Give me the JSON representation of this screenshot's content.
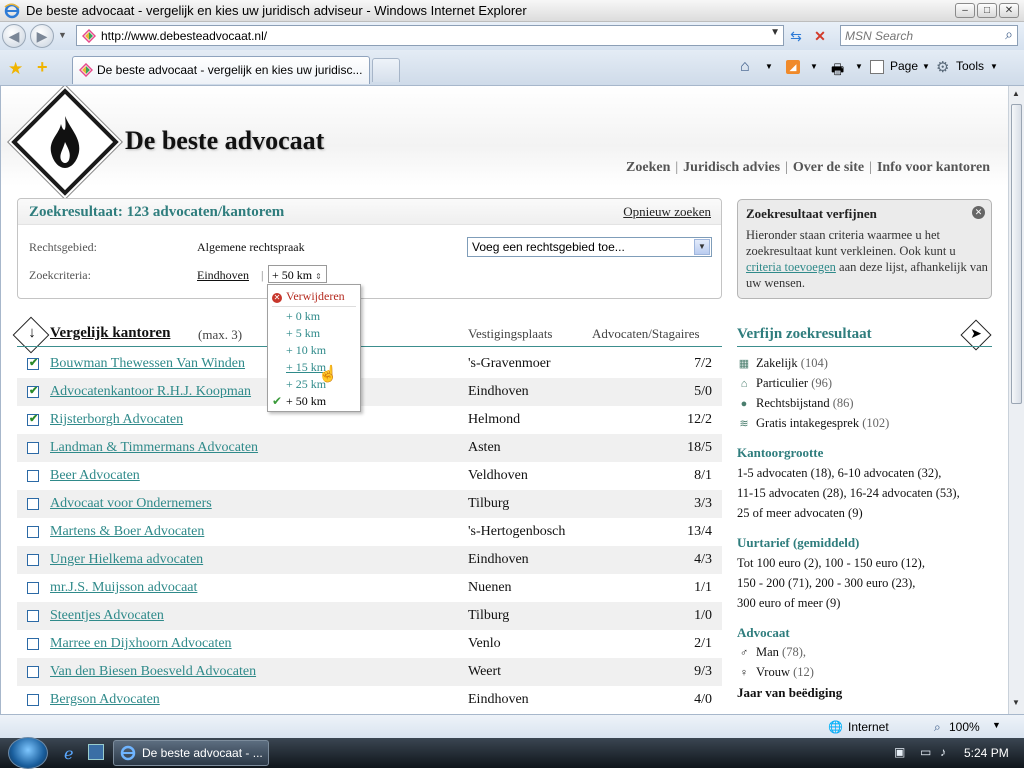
{
  "window": {
    "title": "De beste advocaat - vergelijk en kies uw juridisch adviseur - Windows Internet Explorer",
    "buttons": {
      "minimize": "–",
      "maximize": "□",
      "close": "✕"
    }
  },
  "address_bar": {
    "url": "http://www.debesteadvocaat.nl/",
    "search_placeholder": "MSN Search"
  },
  "tabs": [
    {
      "label": "De beste advocaat - vergelijk en kies uw juridisc..."
    }
  ],
  "command_bar": {
    "page": "Page",
    "tools": "Tools"
  },
  "site": {
    "title": "De beste advocaat",
    "nav": [
      "Zoeken",
      "Juridisch advies",
      "Over de site",
      "Info voor kantoren"
    ],
    "nav_sep": "|"
  },
  "results": {
    "title": "Zoekresultaat: 123 advocaten/kantorem",
    "reset_link": "Opnieuw zoeken",
    "rechtsgebied_label": "Rechtsgebied:",
    "rechtsgebied_value": "Algemene rechtspraak",
    "add_select": "Voeg een rechtsgebied toe...",
    "criteria_label": "Zoekcriteria:",
    "criteria_city": "Eindhoven",
    "criteria_sep": "|",
    "criteria_distance": "+ 50 km"
  },
  "distance_dropdown": {
    "remove": "Verwijderen",
    "options": [
      "+ 0 km",
      "+ 5 km",
      "+ 10 km",
      "+ 15 km",
      "+ 25 km",
      "+ 50 km"
    ],
    "selected": "+ 50 km"
  },
  "compare": {
    "title": "Vergelijk kantoren",
    "max": "(max. 3)",
    "col_city": "Vestigingsplaats",
    "col_count": "Advocaten/Stagaires"
  },
  "firms": [
    {
      "name": "Bouwman Thewessen Van Winden",
      "city": "'s-Gravenmoer",
      "count": "7/2",
      "checked": true
    },
    {
      "name": "Advocatenkantoor R.H.J. Koopman",
      "city": "Eindhoven",
      "count": "5/0",
      "checked": true
    },
    {
      "name": "Rijsterborgh Advocaten",
      "city": "Helmond",
      "count": "12/2",
      "checked": true
    },
    {
      "name": "Landman & Timmermans Advocaten",
      "city": "Asten",
      "count": "18/5",
      "checked": false
    },
    {
      "name": "Beer Advocaten",
      "city": "Veldhoven",
      "count": "8/1",
      "checked": false
    },
    {
      "name": "Advocaat voor Ondernemers",
      "city": "Tilburg",
      "count": "3/3",
      "checked": false
    },
    {
      "name": "Martens & Boer Advocaten",
      "city": "'s-Hertogenbosch",
      "count": "13/4",
      "checked": false
    },
    {
      "name": "Unger Hielkema advocaten",
      "city": "Eindhoven",
      "count": "4/3",
      "checked": false
    },
    {
      "name": "mr.J.S. Muijsson advocaat",
      "city": "Nuenen",
      "count": "1/1",
      "checked": false
    },
    {
      "name": "Steentjes Advocaten",
      "city": "Tilburg",
      "count": "1/0",
      "checked": false
    },
    {
      "name": "Marree en Dijxhoorn Advocaten",
      "city": "Venlo",
      "count": "2/1",
      "checked": false
    },
    {
      "name": "Van den Biesen Boesveld Advocaten",
      "city": "Weert",
      "count": "9/3",
      "checked": false
    },
    {
      "name": "Bergson Advocaten",
      "city": "Eindhoven",
      "count": "4/0",
      "checked": false
    }
  ],
  "refine_box": {
    "title": "Zoekresultaat verfijnen",
    "text_before": "Hieronder staan criteria waarmee u het zoekresultaat kunt verkleinen. Ook kunt u ",
    "link": "criteria toevoegen",
    "text_after": " aan deze lijst, afhankelijk van uw wensen."
  },
  "refine": {
    "title": "Verfijn zoekresultaat",
    "types": [
      {
        "label": "Zakelijk",
        "n": "(104)"
      },
      {
        "label": "Particulier",
        "n": "(96)"
      },
      {
        "label": "Rechtsbijstand",
        "n": "(86)"
      },
      {
        "label": "Gratis intakegesprek",
        "n": "(102)"
      }
    ],
    "size_title": "Kantoorgrootte",
    "size_lines": [
      "1-5 advocaten (18), 6-10 advocaten (32),",
      "11-15 advocaten (28), 16-24 advocaten (53),",
      "25 of meer advocaten (9)"
    ],
    "rate_title": "Uurtarief (gemiddeld)",
    "rate_lines": [
      "Tot 100 euro (2), 100 - 150 euro (12),",
      "150 - 200 (71), 200 - 300 euro (23),",
      "300 euro of meer  (9)"
    ],
    "advocaat_title": "Advocaat",
    "gender": [
      {
        "label": "Man",
        "n": "(78),"
      },
      {
        "label": "Vrouw",
        "n": "(12)"
      }
    ],
    "year_title": "Jaar van beëdiging"
  },
  "status_bar": {
    "zone": "Internet",
    "zoom": "100%"
  },
  "taskbar": {
    "task": "De beste advocaat - ...",
    "clock": "5:24 PM"
  }
}
